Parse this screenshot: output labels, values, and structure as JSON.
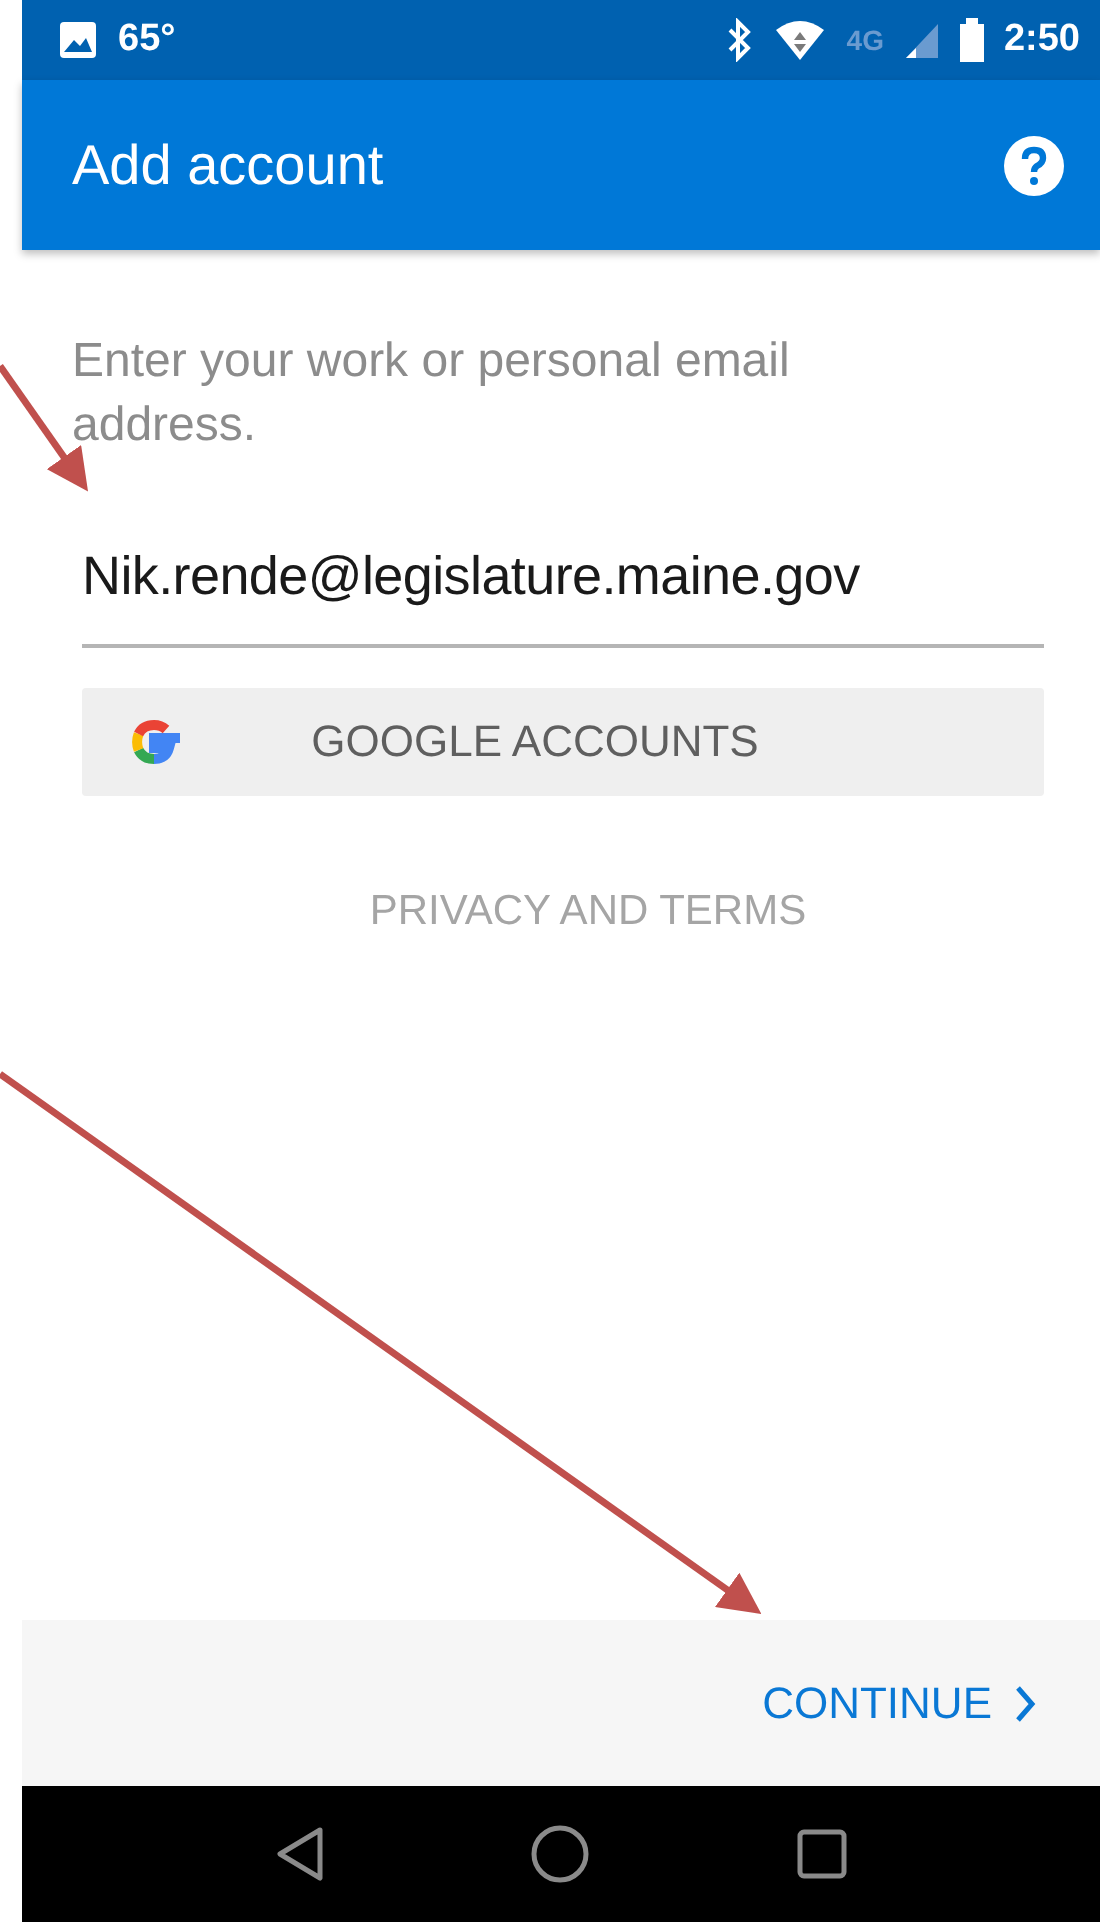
{
  "status_bar": {
    "temperature": "65°",
    "network": "4G",
    "time": "2:50"
  },
  "app_bar": {
    "title": "Add account"
  },
  "prompt": "Enter your work or personal email address.",
  "email_field": {
    "value": "Nik.rende@legislature.maine.gov"
  },
  "google_button": {
    "label": "GOOGLE ACCOUNTS"
  },
  "privacy_link": "PRIVACY AND TERMS",
  "footer": {
    "continue": "CONTINUE"
  }
}
